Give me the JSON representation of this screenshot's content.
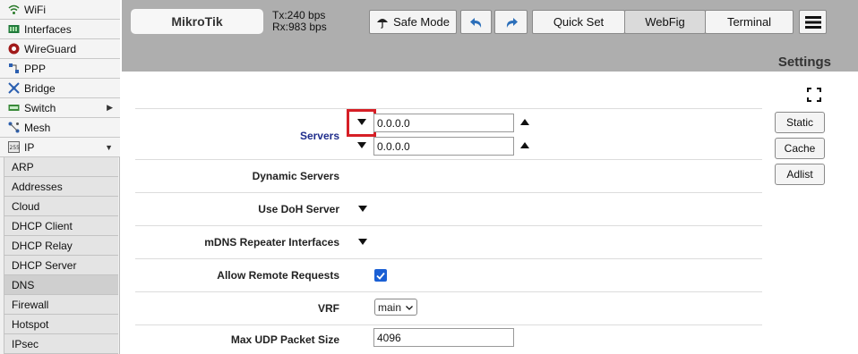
{
  "sidebar": {
    "items": [
      {
        "label": "WiFi",
        "icon": "wifi-icon"
      },
      {
        "label": "Interfaces",
        "icon": "interfaces-icon"
      },
      {
        "label": "WireGuard",
        "icon": "wireguard-icon"
      },
      {
        "label": "PPP",
        "icon": "ppp-icon"
      },
      {
        "label": "Bridge",
        "icon": "bridge-icon"
      },
      {
        "label": "Switch",
        "icon": "switch-icon",
        "arrow": "▶"
      },
      {
        "label": "Mesh",
        "icon": "mesh-icon"
      },
      {
        "label": "IP",
        "icon": "ip-icon",
        "arrow": "▼"
      }
    ],
    "ip_submenu": [
      "ARP",
      "Addresses",
      "Cloud",
      "DHCP Client",
      "DHCP Relay",
      "DHCP Server",
      "DNS",
      "Firewall",
      "Hotspot",
      "IPsec"
    ],
    "active_submenu": "DNS"
  },
  "header": {
    "brand": "MikroTik",
    "tx": "Tx:240 bps",
    "rx": "Rx:983 bps",
    "safe_mode": "Safe Mode",
    "quick_set": "Quick Set",
    "webfig": "WebFig",
    "terminal": "Terminal",
    "page_title": "Settings"
  },
  "form": {
    "servers_label": "Servers",
    "server1": "0.0.0.0",
    "server2": "0.0.0.0",
    "dynamic_servers_label": "Dynamic Servers",
    "doh_label": "Use DoH Server",
    "mdns_label": "mDNS Repeater Interfaces",
    "allow_remote_label": "Allow Remote Requests",
    "allow_remote_checked": true,
    "vrf_label": "VRF",
    "vrf_value": "main",
    "max_udp_label": "Max UDP Packet Size",
    "max_udp_value": "4096"
  },
  "actions": {
    "static": "Static",
    "cache": "Cache",
    "adlist": "Adlist"
  },
  "colors": {
    "header_bg": "#aeaeae",
    "highlight": "#d61f26",
    "checkbox": "#1a5fd4",
    "servers_label": "#1f2d8c"
  }
}
